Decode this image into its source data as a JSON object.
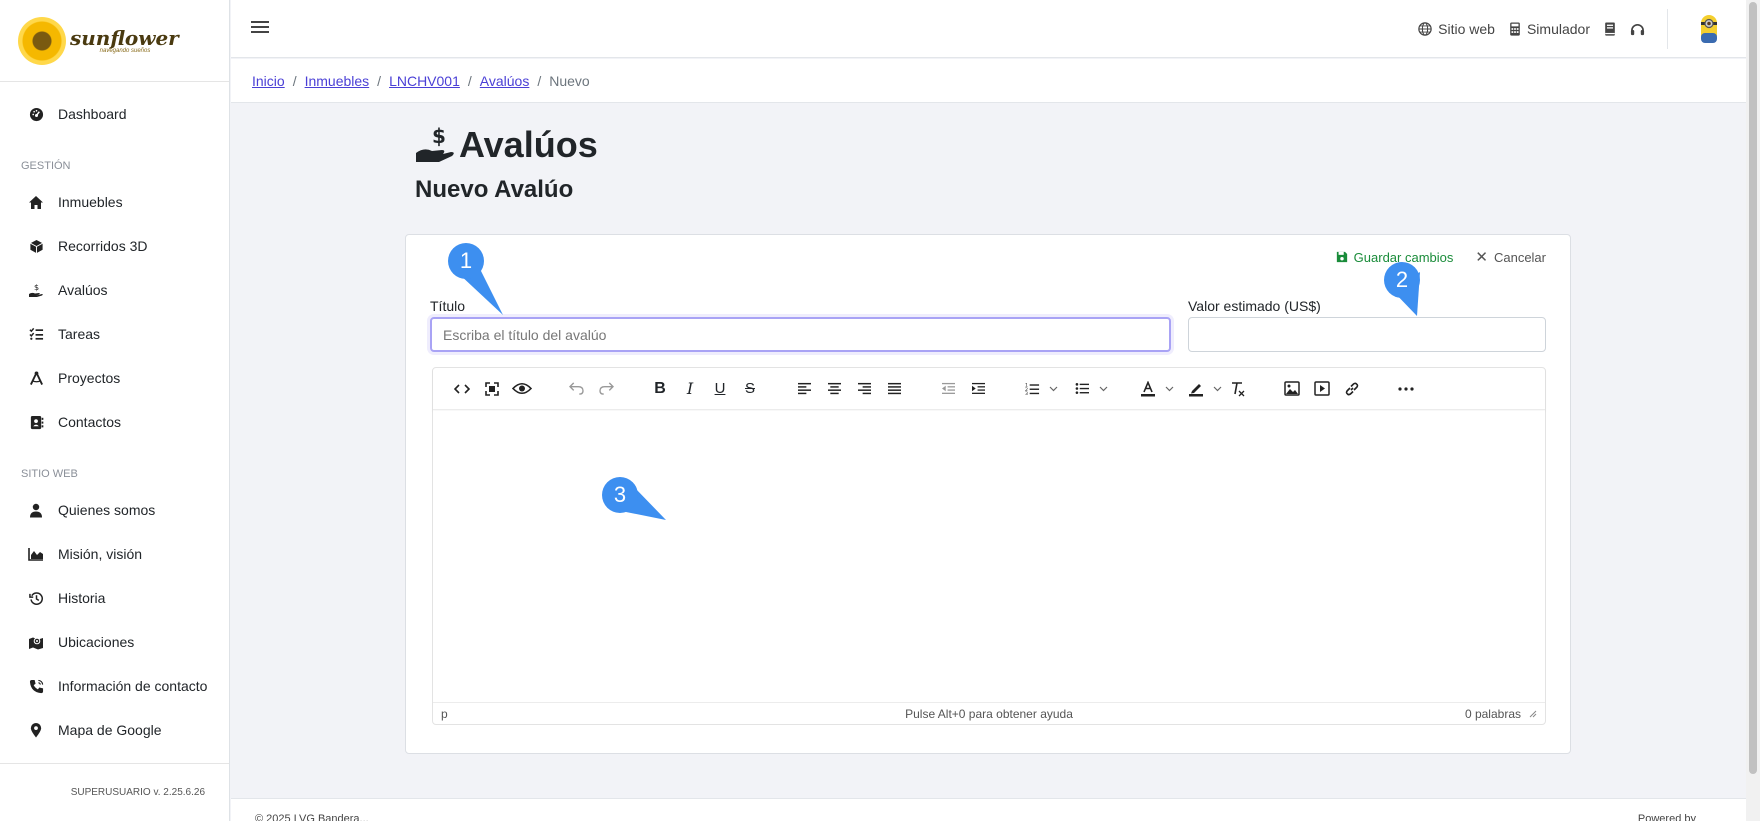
{
  "brand": {
    "name": "sunflower",
    "tagline": "navegando sueños"
  },
  "sidebar": {
    "items_top": [
      {
        "label": "Dashboard",
        "icon": "dashboard-icon"
      }
    ],
    "section_gestion": "GESTIÓN",
    "items_gestion": [
      {
        "label": "Inmuebles",
        "icon": "home-icon"
      },
      {
        "label": "Recorridos 3D",
        "icon": "cube-icon"
      },
      {
        "label": "Avalúos",
        "icon": "hand-dollar-icon"
      },
      {
        "label": "Tareas",
        "icon": "tasks-icon"
      },
      {
        "label": "Proyectos",
        "icon": "compass-icon"
      },
      {
        "label": "Contactos",
        "icon": "address-book-icon"
      }
    ],
    "section_web": "SITIO WEB",
    "items_web": [
      {
        "label": "Quienes somos",
        "icon": "user-icon"
      },
      {
        "label": "Misión, visión",
        "icon": "chart-area-icon"
      },
      {
        "label": "Historia",
        "icon": "history-icon"
      },
      {
        "label": "Ubicaciones",
        "icon": "map-icon"
      },
      {
        "label": "Información de contacto",
        "icon": "phone-icon"
      },
      {
        "label": "Mapa de Google",
        "icon": "map-pin-icon"
      }
    ],
    "footer": "SUPERUSUARIO v. 2.25.6.26"
  },
  "topbar": {
    "site_label": "Sitio web",
    "simulator_label": "Simulador"
  },
  "breadcrumb": {
    "items": [
      "Inicio",
      "Inmuebles",
      "LNCHV001",
      "Avalúos"
    ],
    "current": "Nuevo",
    "separator": "/"
  },
  "page": {
    "title": "Avalúos",
    "subtitle": "Nuevo Avalúo"
  },
  "form": {
    "save_label": "Guardar cambios",
    "cancel_label": "Cancelar",
    "title_label": "Título",
    "title_placeholder": "Escriba el título del avalúo",
    "value_label": "Valor estimado (US$)",
    "value_value": ""
  },
  "editor": {
    "status_element": "p",
    "help_text": "Pulse Alt+0 para obtener ayuda",
    "word_count": "0 palabras"
  },
  "markers": [
    "1",
    "2",
    "3"
  ],
  "footer": {
    "left": "© 2025 LVG Bandera...",
    "right": "Powered by"
  },
  "colors": {
    "accent": "#4a3fd6",
    "save": "#1a8c3a",
    "marker": "#3d8ff0",
    "focus": "#a9a3f5"
  }
}
